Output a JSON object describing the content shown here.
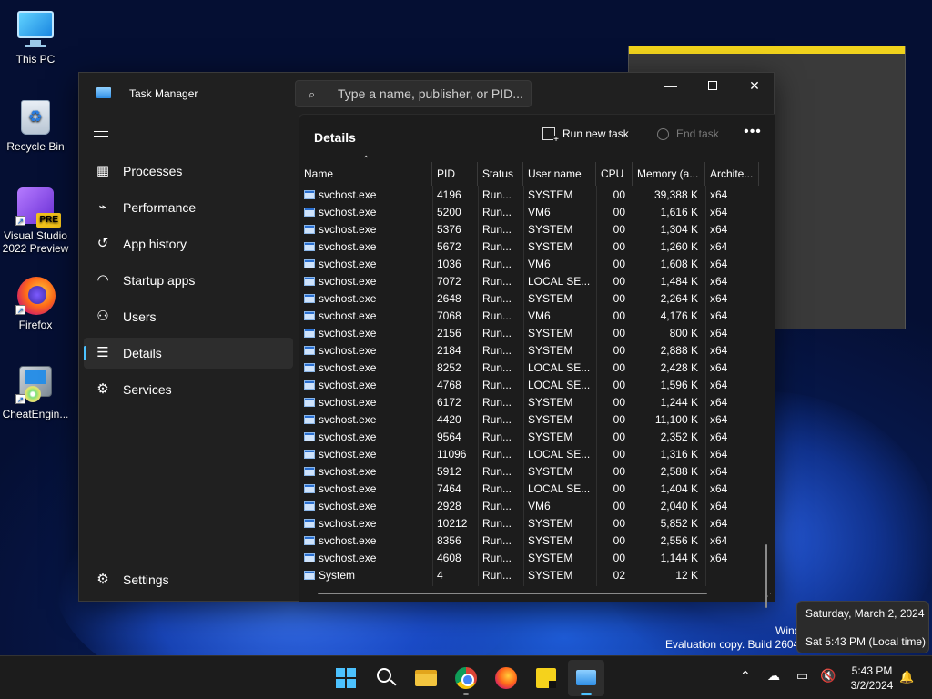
{
  "desktop": {
    "icons": [
      {
        "label": "This PC"
      },
      {
        "label": "Recycle Bin"
      },
      {
        "label": "Visual Studio 2022 Preview",
        "badge": "PRE"
      },
      {
        "label": "Firefox"
      },
      {
        "label": "CheatEngin..."
      }
    ],
    "watermark_line1": "Wind",
    "watermark_line2": "Evaluation copy. Build 2604"
  },
  "task_manager": {
    "title": "Task Manager",
    "search_placeholder": "Type a name, publisher, or PID...",
    "nav": [
      {
        "label": "Processes",
        "icon": "processes-icon"
      },
      {
        "label": "Performance",
        "icon": "performance-icon"
      },
      {
        "label": "App history",
        "icon": "history-icon"
      },
      {
        "label": "Startup apps",
        "icon": "startup-icon"
      },
      {
        "label": "Users",
        "icon": "users-icon"
      },
      {
        "label": "Details",
        "icon": "details-icon",
        "active": true
      },
      {
        "label": "Services",
        "icon": "services-icon"
      }
    ],
    "settings_label": "Settings",
    "page_title": "Details",
    "run_new_task": "Run new task",
    "end_task": "End task",
    "columns": [
      "Name",
      "PID",
      "Status",
      "User name",
      "CPU",
      "Memory (a...",
      "Archite..."
    ],
    "rows": [
      [
        "svchost.exe",
        "4196",
        "Run...",
        "SYSTEM",
        "00",
        "39,388 K",
        "x64"
      ],
      [
        "svchost.exe",
        "5200",
        "Run...",
        "VM6",
        "00",
        "1,616 K",
        "x64"
      ],
      [
        "svchost.exe",
        "5376",
        "Run...",
        "SYSTEM",
        "00",
        "1,304 K",
        "x64"
      ],
      [
        "svchost.exe",
        "5672",
        "Run...",
        "SYSTEM",
        "00",
        "1,260 K",
        "x64"
      ],
      [
        "svchost.exe",
        "1036",
        "Run...",
        "VM6",
        "00",
        "1,608 K",
        "x64"
      ],
      [
        "svchost.exe",
        "7072",
        "Run...",
        "LOCAL SE...",
        "00",
        "1,484 K",
        "x64"
      ],
      [
        "svchost.exe",
        "2648",
        "Run...",
        "SYSTEM",
        "00",
        "2,264 K",
        "x64"
      ],
      [
        "svchost.exe",
        "7068",
        "Run...",
        "VM6",
        "00",
        "4,176 K",
        "x64"
      ],
      [
        "svchost.exe",
        "2156",
        "Run...",
        "SYSTEM",
        "00",
        "800 K",
        "x64"
      ],
      [
        "svchost.exe",
        "2184",
        "Run...",
        "SYSTEM",
        "00",
        "2,888 K",
        "x64"
      ],
      [
        "svchost.exe",
        "8252",
        "Run...",
        "LOCAL SE...",
        "00",
        "2,428 K",
        "x64"
      ],
      [
        "svchost.exe",
        "4768",
        "Run...",
        "LOCAL SE...",
        "00",
        "1,596 K",
        "x64"
      ],
      [
        "svchost.exe",
        "6172",
        "Run...",
        "SYSTEM",
        "00",
        "1,244 K",
        "x64"
      ],
      [
        "svchost.exe",
        "4420",
        "Run...",
        "SYSTEM",
        "00",
        "11,100 K",
        "x64"
      ],
      [
        "svchost.exe",
        "9564",
        "Run...",
        "SYSTEM",
        "00",
        "2,352 K",
        "x64"
      ],
      [
        "svchost.exe",
        "11096",
        "Run...",
        "LOCAL SE...",
        "00",
        "1,316 K",
        "x64"
      ],
      [
        "svchost.exe",
        "5912",
        "Run...",
        "SYSTEM",
        "00",
        "2,588 K",
        "x64"
      ],
      [
        "svchost.exe",
        "7464",
        "Run...",
        "LOCAL SE...",
        "00",
        "1,404 K",
        "x64"
      ],
      [
        "svchost.exe",
        "2928",
        "Run...",
        "VM6",
        "00",
        "2,040 K",
        "x64"
      ],
      [
        "svchost.exe",
        "10212",
        "Run...",
        "SYSTEM",
        "00",
        "5,852 K",
        "x64"
      ],
      [
        "svchost.exe",
        "8356",
        "Run...",
        "SYSTEM",
        "00",
        "2,556 K",
        "x64"
      ],
      [
        "svchost.exe",
        "4608",
        "Run...",
        "SYSTEM",
        "00",
        "1,144 K",
        "x64"
      ],
      [
        "System",
        "4",
        "Run...",
        "SYSTEM",
        "02",
        "12 K",
        ""
      ]
    ]
  },
  "tooltip": {
    "date_long": "Saturday, March 2, 2024",
    "time_local": "Sat 5:43 PM (Local time)"
  },
  "taskbar": {
    "time": "5:43 PM",
    "date": "3/2/2024"
  },
  "colors": {
    "accent": "#4cc2ff",
    "window_bg": "#202020",
    "content_bg": "#1c1c1c"
  }
}
